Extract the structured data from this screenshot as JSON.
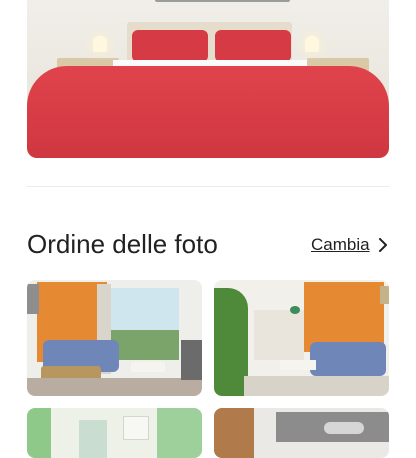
{
  "photos": {
    "hero": {
      "icon": "bedroom-photo",
      "alt_colors": [
        "#d63a45",
        "#e0434c",
        "#e6dccb"
      ]
    },
    "grid": [
      {
        "icon": "living-room-photo"
      },
      {
        "icon": "living-room-kitchen-photo"
      },
      {
        "icon": "bathroom-photo"
      },
      {
        "icon": "bedroom-wall-art-photo"
      }
    ]
  },
  "section": {
    "title": "Ordine delle foto",
    "change_label": "Cambia"
  },
  "colors": {
    "text": "#222222",
    "divider": "#ebebeb",
    "accent_red": "#d63a45",
    "orange_wall": "#e58a33",
    "sofa_blue": "#6f86b8"
  }
}
